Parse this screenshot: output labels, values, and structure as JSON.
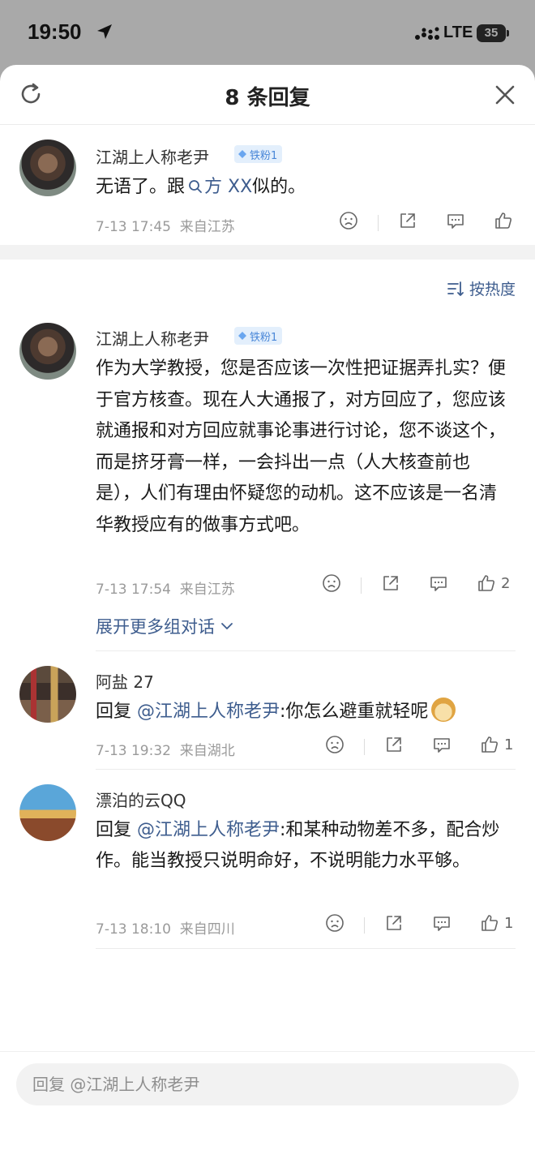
{
  "status": {
    "time": "19:50",
    "network": "LTE",
    "battery": "35"
  },
  "header": {
    "title": "8 条回复"
  },
  "sort": {
    "label": "按热度"
  },
  "root_comment": {
    "username": "江湖上人称老尹",
    "badge": "铁粉1",
    "text_prefix": "无语了。跟",
    "search_link": "方 XX",
    "text_suffix": "似的。",
    "time": "7-13 17:45",
    "location": "来自江苏"
  },
  "comments": [
    {
      "username": "江湖上人称老尹",
      "badge": "铁粉1",
      "text": "作为大学教授，您是否应该一次性把证据弄扎实？便于官方核查。现在人大通报了，对方回应了，您应该就通报和对方回应就事论事进行讨论，您不谈这个，而是挤牙膏一样，一会抖出一点（人大核查前也是），人们有理由怀疑您的动机。这不应该是一名清华教授应有的做事方式吧。",
      "time": "7-13 17:54",
      "location": "来自江苏",
      "likes": "2",
      "expand_label": "展开更多组对话"
    },
    {
      "username": "阿盐 27",
      "reply_prefix": "回复 ",
      "mention": "@江湖上人称老尹",
      "text": ":你怎么避重就轻呢",
      "time": "7-13 19:32",
      "location": "来自湖北",
      "likes": "1"
    },
    {
      "username": "漂泊的云QQ",
      "reply_prefix": "回复 ",
      "mention": "@江湖上人称老尹",
      "text": ":和某种动物差不多，配合炒作。能当教授只说明命好，不说明能力水平够。",
      "time": "7-13 18:10",
      "location": "来自四川",
      "likes": "1"
    }
  ],
  "reply_box": {
    "placeholder": "回复 @江湖上人称老尹"
  },
  "colors": {
    "link": "#3e5d8e",
    "badge_bg": "#e3effc",
    "badge_text": "#4a87d8"
  }
}
